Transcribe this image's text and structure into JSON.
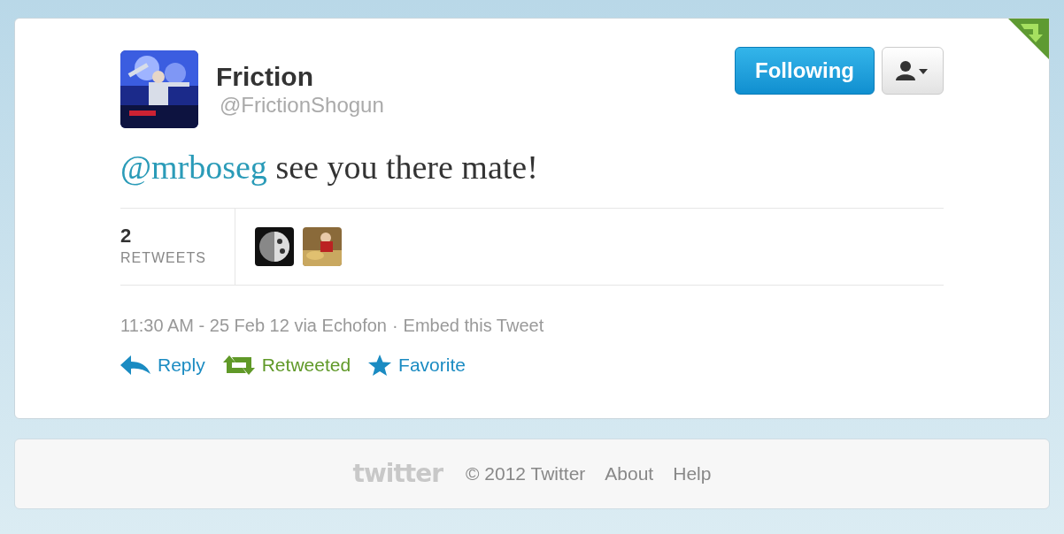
{
  "tweet": {
    "author": {
      "name": "Friction",
      "handle": "@FrictionShogun"
    },
    "follow_button": {
      "label": "Following",
      "following": true
    },
    "retweeted_badge": true,
    "mention": "@mrboseg",
    "text": " see you there mate!",
    "stats": {
      "count": "2",
      "label": "RETWEETS"
    },
    "meta": {
      "time": "11:30 AM - 25 Feb 12 via Echofon",
      "separator": "·",
      "embed": "Embed this Tweet"
    },
    "actions": [
      {
        "kind": "reply",
        "label": "Reply",
        "active": false
      },
      {
        "kind": "retweet",
        "label": "Retweeted",
        "active": true
      },
      {
        "kind": "favorite",
        "label": "Favorite",
        "active": false
      }
    ]
  },
  "footer": {
    "logo": "twitter",
    "links": [
      "© 2012 Twitter",
      "About",
      "Help"
    ]
  }
}
